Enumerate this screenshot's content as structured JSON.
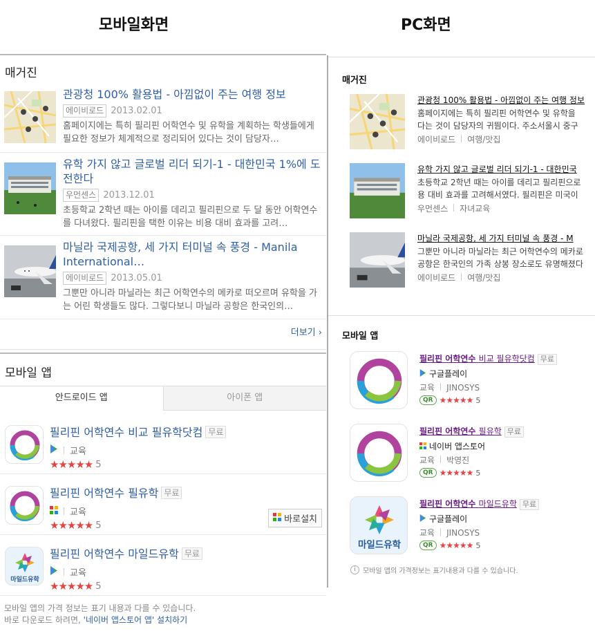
{
  "headers": {
    "mobile": "모바일화면",
    "pc": "PC화면"
  },
  "mobile": {
    "magazine_title": "매거진",
    "articles": [
      {
        "title": "관광청 100% 활용법 - 아낌없이 주는 여행 정보",
        "source": "에이비로드",
        "date": "2013.02.01",
        "desc": "홈페이지에는 특히 필리핀 어학연수 및 유학을 계획하는 학생들에게 필요한 정보가 체계적으로 정리되어 있다는 것이 담당자…"
      },
      {
        "title": "유학 가지 않고 글로벌 리더 되기-1 - 대한민국 1%에 도전한다",
        "source": "우먼센스",
        "date": "2013.12.01",
        "desc": "초등학교 2학년 때는 아이를 데리고 필리핀으로 두 달 동안 어학연수를 다녀왔다. 필리핀을 택한 이유는 비용 대비 효과를 고려…"
      },
      {
        "title": "마닐라 국제공항, 세 가지 터미널 속 풍경 - Manila International…",
        "source": "에이비로드",
        "date": "2013.05.01",
        "desc": "그뿐만 아니라 마닐라는 최근 어학연수의 메카로 떠오르며 유학을 가는 어린 학생들도 많다. 그렇다보니 마닐라 공항은 한국인의…"
      }
    ],
    "more": "더보기",
    "app_title": "모바일 앱",
    "tabs": [
      "안드로이드 앱",
      "아이폰 앱"
    ],
    "apps": [
      {
        "name": "필리핀 어학연수 비교 필유학닷컴",
        "free": "무료",
        "category": "교육",
        "rating": "5"
      },
      {
        "name": "필리핀 어학연수 필유학",
        "free": "무료",
        "category": "교육",
        "rating": "5",
        "install": "바로설치"
      },
      {
        "name": "필리핀 어학연수 마일드유학",
        "free": "무료",
        "category": "교육",
        "rating": "5"
      }
    ],
    "note1": "모바일 앱의 가격 정보는 표기 내용과 다를 수 있습니다.",
    "note2_prefix": "바로 다운로드 하려면,",
    "note2_link": "'네이버 앱스토어 앱'",
    "note2_suffix": "설치하기"
  },
  "pc": {
    "magazine_title": "매거진",
    "articles": [
      {
        "title": "관광청 100% 활용법 - 아낌없이 주는 여행 정보",
        "line1": "홈페이지에는 특히 필리핀 어학연수 및 유학을",
        "line2": "다는 것이 담당자의 귀띔이다. 주소서울시 중구",
        "source": "에이비로드",
        "category": "여행/맛집"
      },
      {
        "title": "유학 가지 않고 글로벌 리더 되기-1 - 대한민국",
        "line1": "초등학교 2학년 때는 아이를 데리고 필리핀으로",
        "line2": "용 대비 효과를 고려해서였다. 필리핀은 미국이",
        "source": "우먼센스",
        "category": "자녀교육"
      },
      {
        "title": "마닐라 국제공항, 세 가지 터미널 속 풍경 - M",
        "line1": "그뿐만 아니라 마닐라는 최근 어학연수의 메카로",
        "line2": "공항은 한국인의 가족 상봉 장소로도 유명해졌다",
        "source": "에이비로드",
        "category": "여행/맛집"
      }
    ],
    "app_title": "모바일 앱",
    "apps": [
      {
        "name_bold": "필리핀 어학연수",
        "name_rest": "비교 필유학닷컴",
        "free": "무료",
        "store": "구글플레이",
        "category": "교육",
        "developer": "JINOSYS",
        "qr": "QR",
        "rating": "5"
      },
      {
        "name_bold": "필리핀 어학연수",
        "name_rest": "필유학",
        "free": "무료",
        "store": "네이버 앱스토어",
        "category": "교육",
        "developer": "박영진",
        "qr": "QR",
        "rating": "5"
      },
      {
        "name_bold": "필리핀 어학연수",
        "name_rest": "마일드유학",
        "free": "무료",
        "store": "구글플레이",
        "category": "교육",
        "developer": "JINOSYS",
        "qr": "QR",
        "rating": "5"
      }
    ],
    "note": "모바일 앱의 가격정보는 표기내용과 다를 수 있습니다."
  },
  "stars": "★★★★★",
  "icon_text": {
    "mild": "마일드유학"
  },
  "colors": {
    "link_blue": "#2f5fa6",
    "visited_purple": "#6b1a8a",
    "star_red": "#e34545",
    "qr_green": "#3b8b2c"
  }
}
